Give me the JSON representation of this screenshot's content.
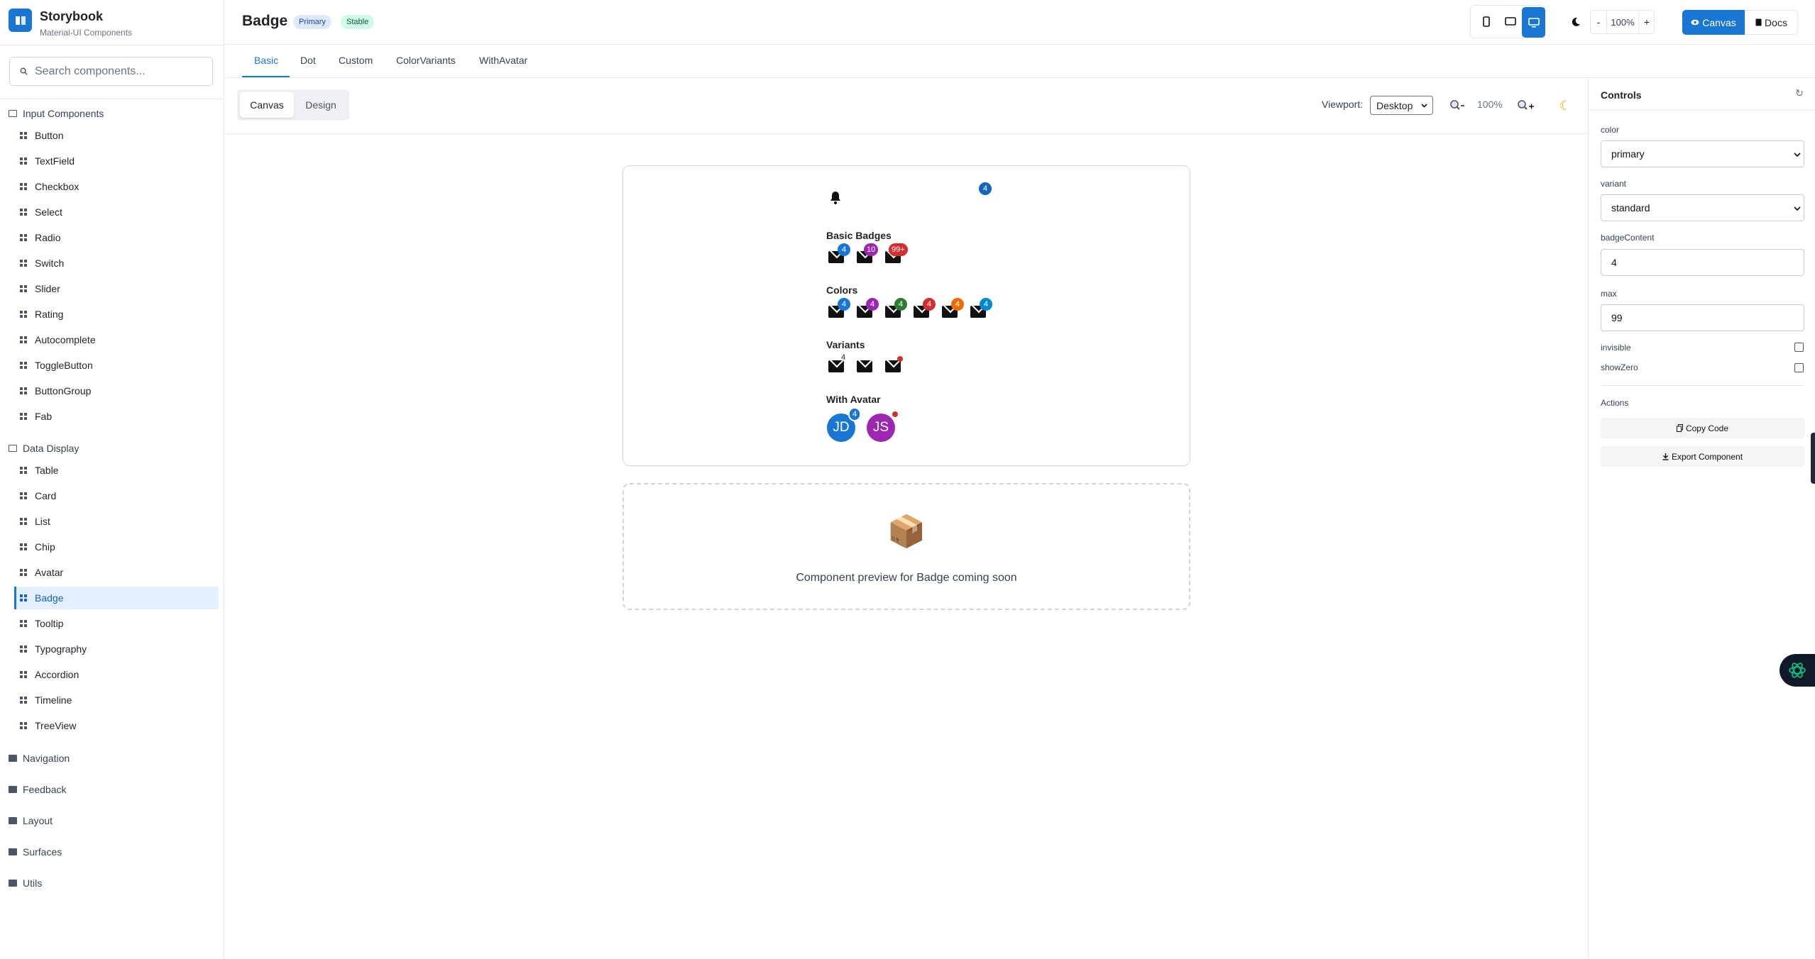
{
  "sidebar": {
    "title": "Storybook",
    "subtitle": "Material-UI Components",
    "search_placeholder": "Search components...",
    "groups": [
      {
        "label": "Input Components",
        "items": [
          "Button",
          "TextField",
          "Checkbox",
          "Select",
          "Radio",
          "Switch",
          "Slider",
          "Rating",
          "Autocomplete",
          "ToggleButton",
          "ButtonGroup",
          "Fab"
        ]
      },
      {
        "label": "Data Display",
        "items": [
          "Table",
          "Card",
          "List",
          "Chip",
          "Avatar",
          "Badge",
          "Tooltip",
          "Typography",
          "Accordion",
          "Timeline",
          "TreeView"
        ]
      },
      {
        "label": "Navigation"
      },
      {
        "label": "Feedback"
      },
      {
        "label": "Layout"
      },
      {
        "label": "Surfaces"
      },
      {
        "label": "Utils"
      }
    ],
    "selected": "Badge"
  },
  "header": {
    "title": "Badge",
    "chip_primary": "Primary",
    "chip_stable": "Stable",
    "zoom_minus": "-",
    "zoom": "100%",
    "zoom_plus": "+",
    "canvas": "Canvas",
    "docs": "Docs"
  },
  "tabs": [
    "Basic",
    "Dot",
    "Custom",
    "ColorVariants",
    "WithAvatar"
  ],
  "toolbar": {
    "canvas": "Canvas",
    "design": "Design",
    "viewport_label": "Viewport:",
    "viewport_value": "Desktop",
    "zoom": "100%"
  },
  "preview": {
    "top_badge": "4",
    "basic_title": "Basic Badges",
    "basic_badges": [
      "4",
      "10",
      "99+"
    ],
    "colors_title": "Colors",
    "color_badges": [
      "4",
      "4",
      "4",
      "4",
      "4",
      "4"
    ],
    "variants_title": "Variants",
    "variant_badge": "4",
    "avatar_title": "With Avatar",
    "avatars": [
      "JD",
      "JS"
    ],
    "avatar_badge": "4",
    "placeholder_icon": "📦",
    "placeholder_text": "Component preview for Badge coming soon"
  },
  "colors": {
    "primary": "#1976d2",
    "secondary": "#9c27b0",
    "success": "#2e7d32",
    "error": "#d32f2f",
    "warning": "#ed6c02",
    "info": "#0288d1",
    "stable_bg": "#d1fae5"
  },
  "controls": {
    "title": "Controls",
    "color_label": "color",
    "color_value": "primary",
    "variant_label": "variant",
    "variant_value": "standard",
    "badgeContent_label": "badgeContent",
    "badgeContent_value": "4",
    "max_label": "max",
    "max_value": "99",
    "invisible_label": "invisible",
    "showZero_label": "showZero",
    "actions_label": "Actions",
    "copy_code": "Copy Code",
    "export_component": "Export Component"
  }
}
